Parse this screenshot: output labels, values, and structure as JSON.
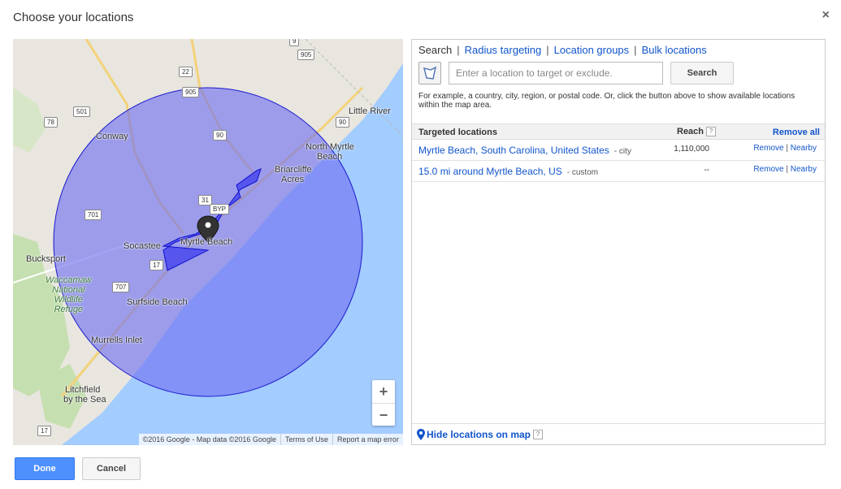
{
  "dialog": {
    "title": "Choose your locations",
    "close": "×"
  },
  "map": {
    "places": [
      "Conway",
      "Little River",
      "North Myrtle",
      "Beach",
      "Briarcliffe",
      "Acres",
      "Socastee",
      "Myrtle Beach",
      "Bucksport",
      "Surfside Beach",
      "Murrells Inlet",
      "Litchfield",
      "by the Sea"
    ],
    "park": [
      "Waccamaw",
      "National",
      "Wildlife",
      "Refuge"
    ],
    "shields": [
      "9",
      "905",
      "22",
      "905",
      "501",
      "78",
      "90",
      "90",
      "31",
      "BYP",
      "701",
      "17",
      "707",
      "17"
    ],
    "zoom_in": "+",
    "zoom_out": "−",
    "attribution": [
      "©2016 Google - Map data ©2016 Google",
      "Terms of Use",
      "Report a map error"
    ],
    "colors": {
      "water": "#a3ccff",
      "land": "#e8e6df",
      "radius_fill": "#6d6df2",
      "radius_stroke": "#1a1acc"
    }
  },
  "tabs": [
    {
      "label": "Search"
    },
    {
      "label": "Radius targeting"
    },
    {
      "label": "Location groups"
    },
    {
      "label": "Bulk locations"
    }
  ],
  "search": {
    "placeholder": "Enter a location to target or exclude.",
    "button": "Search",
    "hint": "For example, a country, city, region, or postal code. Or, click the button above to show available locations within the map area."
  },
  "table": {
    "header_locations": "Targeted locations",
    "header_reach": "Reach",
    "help": "?",
    "remove_all": "Remove all",
    "rows": [
      {
        "name": "Myrtle Beach, South Carolina, United States",
        "kind": "- city",
        "reach": "1,110,000",
        "remove": "Remove",
        "sep": "|",
        "nearby": "Nearby"
      },
      {
        "name": "15.0 mi around Myrtle Beach, US",
        "kind": "- custom",
        "reach": "--",
        "remove": "Remove",
        "sep": "|",
        "nearby": "Nearby"
      }
    ]
  },
  "hide_map": "Hide locations on map",
  "footer": {
    "done": "Done",
    "cancel": "Cancel"
  }
}
